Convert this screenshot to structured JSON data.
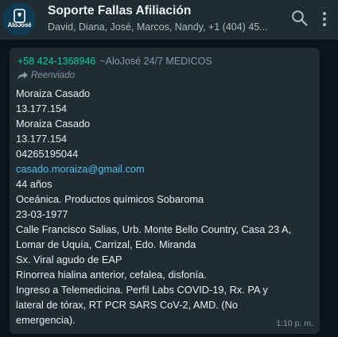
{
  "header": {
    "avatar_text": "AloJosé",
    "title": "Soporte Fallas Afiliación",
    "subtitle": "David, Diana, José, Marcos, Nandy, +1 (404) 45..."
  },
  "message": {
    "sender_phone": "+58 424-1368946",
    "sender_pushname": "~AloJosé 24/7 MEDICOS",
    "forwarded_label": "Reenviado",
    "lines": [
      "Moraiza Casado",
      "13.177.154",
      "Moraiza Casado",
      "13.177.154",
      "04265195044",
      "casado.moraiza@gmail.com",
      "44 años",
      "Oceánica. Productos químicos Sobaroma",
      "23-03-1977",
      "Calle Francisco Salias, Urb. Monte Bello Country, Casa 23 A,",
      "Lomar de Uquía, Carrizal, Edo. Miranda",
      "Sx. Viral agudo de EAP",
      "Rinorrea hialina anterior, cefalea, disfonía.",
      "Ingreso a Telemedicina. Perfil Labs COVID-19, Rx. PA y",
      "lateral de tórax, RT PCR SARS CoV-2, AMD. (No",
      "emergencia)."
    ],
    "time": "1:10 p. m."
  },
  "icons": {
    "search": "search-icon",
    "menu": "more-vertical-icon",
    "forwarded": "forward-arrow-icon"
  },
  "colors": {
    "background": "#0b141a",
    "header": "#202c33",
    "bubble": "#202c33",
    "sender_phone": "#06cf9c",
    "link": "#53bdeb",
    "secondary_text": "#8696a0"
  }
}
